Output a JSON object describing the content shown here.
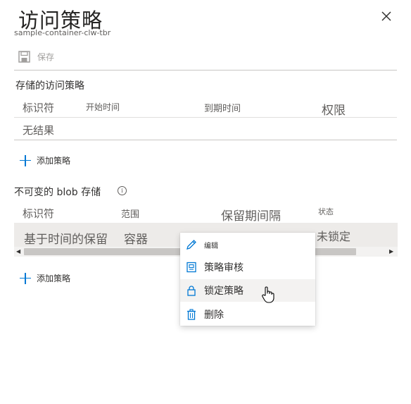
{
  "header": {
    "title": "访问策略",
    "subtitle": "sample-container-clw-tbr"
  },
  "toolbar": {
    "save_label": "保存"
  },
  "stored_policies": {
    "heading": "存储的访问策略",
    "columns": [
      "标识符",
      "开始时间",
      "到期时间",
      "权限"
    ],
    "empty_text": "无结果",
    "add_label": "添加策略"
  },
  "immutable": {
    "heading": "不可变的 blob 存储",
    "columns": [
      "标识符",
      "范围",
      "保留期间隔",
      "状态"
    ],
    "rows": [
      {
        "identifier": "基于时间的保留",
        "scope": "容器",
        "interval": "",
        "status": "未锁定"
      }
    ],
    "add_label": "添加策略"
  },
  "context_menu": {
    "items": [
      {
        "label": "编辑",
        "icon": "pencil-icon"
      },
      {
        "label": "策略审核",
        "icon": "audit-icon"
      },
      {
        "label": "锁定策略",
        "icon": "lock-icon"
      },
      {
        "label": "删除",
        "icon": "trash-icon"
      }
    ]
  },
  "colors": {
    "accent": "#0078d4",
    "selected_row": "#edebe9",
    "menu_hover": "#f3f2f1"
  }
}
